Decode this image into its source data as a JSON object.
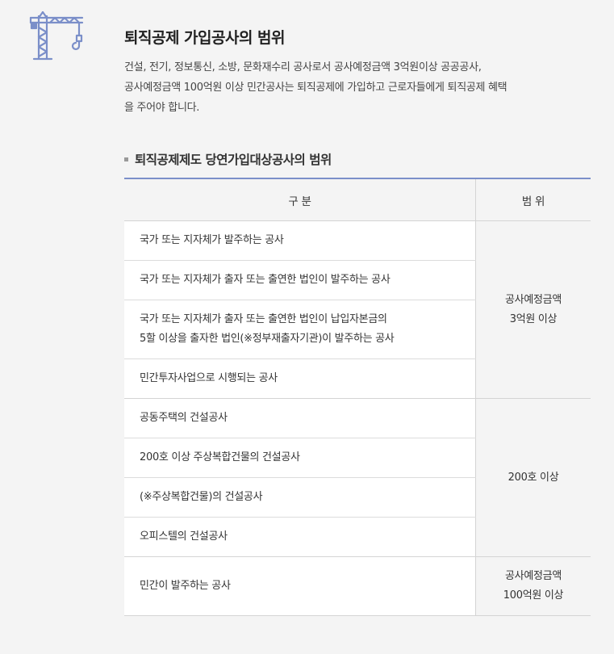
{
  "header": {
    "title": "퇴직공제 가입공사의 범위",
    "description_lines": [
      "건설, 전기, 정보통신, 소방, 문화재수리 공사로서 공사예정금액 3억원이상 공공공사,",
      "공사예정금액 100억원 이상 민간공사는 퇴직공제에 가입하고 근로자들에게 퇴직공제 혜택",
      "을 주어야 합니다."
    ]
  },
  "section": {
    "title": "퇴직공제제도 당연가입대상공사의 범위"
  },
  "table": {
    "headers": [
      "구 분",
      "범 위"
    ],
    "groups": [
      {
        "range_lines": [
          "공사예정금액",
          "3억원 이상"
        ],
        "rows": [
          [
            "국가 또는 지자체가 발주하는 공사"
          ],
          [
            "국가 또는 지자체가 출자 또는 출연한 법인이 발주하는 공사"
          ],
          [
            "국가 또는 지자체가 출자 또는 출연한 법인이 납입자본금의",
            "5할 이상을 출자한 법인(※정부재출자기관)이 발주하는 공사"
          ],
          [
            "민간투자사업으로 시행되는 공사"
          ]
        ]
      },
      {
        "range_lines": [
          "200호 이상"
        ],
        "rows": [
          [
            "공동주택의 건설공사"
          ],
          [
            "200호 이상 주상복합건물의 건설공사"
          ],
          [
            "(※주상복합건물)의 건설공사"
          ],
          [
            "오피스텔의 건설공사"
          ]
        ]
      },
      {
        "range_lines": [
          "공사예정금액",
          "100억원 이상"
        ],
        "rows": [
          [
            "민간이 발주하는 공사"
          ]
        ]
      }
    ]
  },
  "icons": {
    "crane": "crane-icon"
  },
  "colors": {
    "accent": "#7b8fc9",
    "background": "#f4f4f4",
    "cell_background": "#ffffff",
    "border": "#d4d4d4"
  }
}
